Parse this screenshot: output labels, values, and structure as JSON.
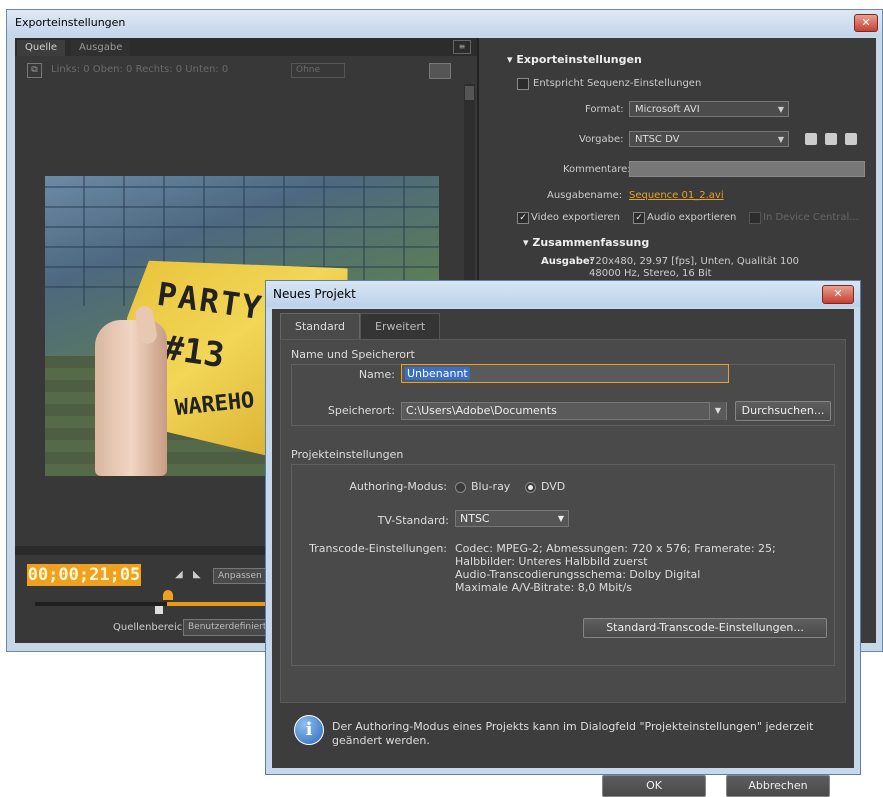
{
  "window": {
    "title": "Exporteinstellungen",
    "close_glyph": "✕"
  },
  "left_panel": {
    "tabs": [
      "Quelle",
      "Ausgabe"
    ],
    "crop_labels": "Links: 0 Oben: 0 Rechts: 0 Unten: 0",
    "crop_dropdown": "Ohne",
    "video": {
      "text_line1": "PARTY",
      "text_line2": "#13",
      "text_line3": "WAREHO"
    },
    "timecode": "00;00;21;05",
    "fit_button": "Anpassen",
    "source_range_label": "Quellenbereich:",
    "source_range_value": "Benutzerdefiniert"
  },
  "right_panel": {
    "section_title": "Exporteinstellungen",
    "match_sequence": "Entspricht Sequenz-Einstellungen",
    "format_label": "Format:",
    "format_value": "Microsoft AVI",
    "preset_label": "Vorgabe:",
    "preset_value": "NTSC DV",
    "comments_label": "Kommentare:",
    "output_name_label": "Ausgabename:",
    "output_name_value": "Sequence 01_2.avi",
    "export_video": "Video exportieren",
    "export_audio": "Audio exportieren",
    "device_central": "In Device Central...",
    "summary_title": "Zusammenfassung",
    "output_label": "Ausgabe:",
    "output_line1": "720x480, 29.97 [fps], Unten, Qualität 100",
    "output_line2": "48000 Hz, Stereo, 16 Bit"
  },
  "dialog": {
    "title": "Neues Projekt",
    "close_glyph": "✕",
    "tabs": [
      "Standard",
      "Erweitert"
    ],
    "group1_title": "Name und Speicherort",
    "name_label": "Name:",
    "name_value": "Unbenannt",
    "location_label": "Speicherort:",
    "location_value": "C:\\Users\\Adobe\\Documents",
    "browse_button": "Durchsuchen...",
    "group2_title": "Projekteinstellungen",
    "authoring_label": "Authoring-Modus:",
    "authoring_options": [
      "Blu-ray",
      "DVD"
    ],
    "tv_label": "TV-Standard:",
    "tv_value": "NTSC",
    "transcode_label": "Transcode-Einstellungen:",
    "transcode_lines": [
      "Codec: MPEG-2; Abmessungen: 720 x 576; Framerate: 25;",
      "Halbbilder: Unteres Halbbild zuerst",
      "Audio-Transcodierungsschema: Dolby Digital",
      "Maximale A/V-Bitrate: 8,0 Mbit/s"
    ],
    "transcode_button": "Standard-Transcode-Einstellungen...",
    "info_text": "Der Authoring-Modus eines Projekts kann im Dialogfeld \"Projekteinstellungen\" jederzeit geändert werden.",
    "ok_button": "OK",
    "cancel_button": "Abbrechen"
  }
}
